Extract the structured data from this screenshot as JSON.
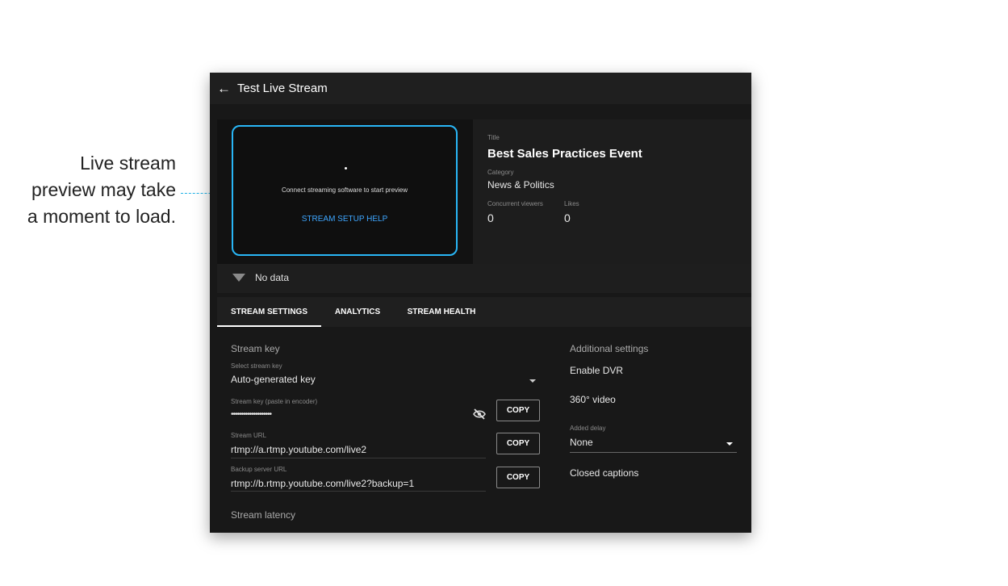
{
  "annotation": {
    "text": "Live stream preview may take a moment to load."
  },
  "header": {
    "title": "Test Live Stream"
  },
  "preview": {
    "message": "Connect streaming software to start preview",
    "help_link": "STREAM SETUP HELP"
  },
  "info": {
    "title_label": "Title",
    "title_value": "Best Sales Practices Event",
    "category_label": "Category",
    "category_value": "News & Politics",
    "viewers_label": "Concurrent viewers",
    "viewers_value": "0",
    "likes_label": "Likes",
    "likes_value": "0"
  },
  "status": {
    "text": "No data"
  },
  "tabs": [
    {
      "label": "STREAM SETTINGS"
    },
    {
      "label": "ANALYTICS"
    },
    {
      "label": "STREAM HEALTH"
    }
  ],
  "stream": {
    "section_title": "Stream key",
    "key_select_label": "Select stream key",
    "key_select_value": "Auto-generated key",
    "key_label": "Stream key (paste in encoder)",
    "key_value": "••••••••••••••••••••",
    "url_label": "Stream URL",
    "url_value": "rtmp://a.rtmp.youtube.com/live2",
    "backup_label": "Backup server URL",
    "backup_value": "rtmp://b.rtmp.youtube.com/live2?backup=1",
    "copy_label": "COPY",
    "latency_title": "Stream latency"
  },
  "additional": {
    "title": "Additional settings",
    "dvr": "Enable DVR",
    "video360": "360° video",
    "delay_label": "Added delay",
    "delay_value": "None",
    "captions": "Closed captions"
  },
  "colors": {
    "accent": "#29b6f6",
    "link": "#3ea6ff",
    "background": "#181818"
  },
  "icons": [
    "back-arrow-icon",
    "wifi-icon",
    "eye-off-icon",
    "dropdown-caret-icon"
  ]
}
